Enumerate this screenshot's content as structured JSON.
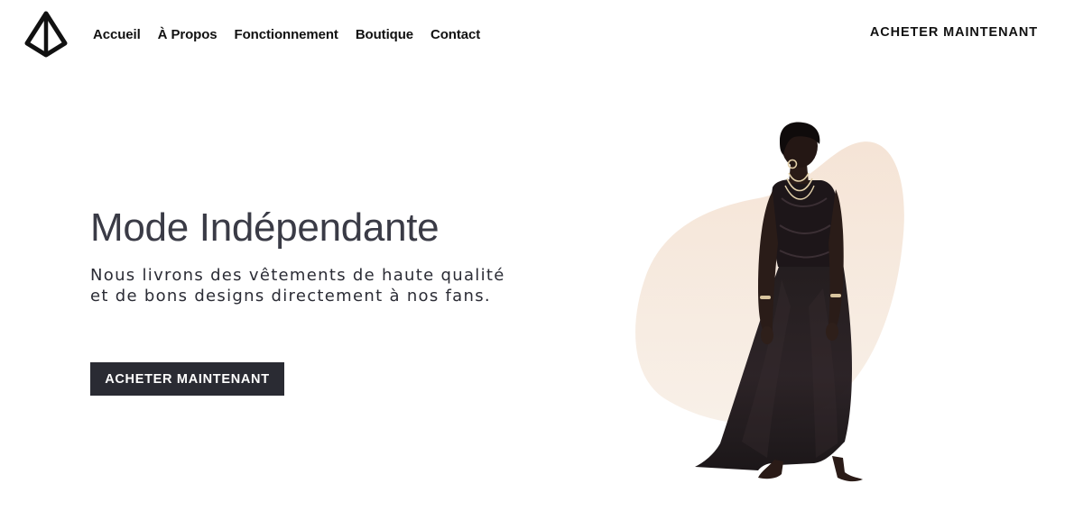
{
  "header": {
    "logo_icon": "diamond-logo-icon",
    "nav": [
      {
        "label": "Accueil"
      },
      {
        "label": "À Propos"
      },
      {
        "label": "Fonctionnement"
      },
      {
        "label": "Boutique"
      },
      {
        "label": "Contact"
      }
    ],
    "cta_label": "ACHETER MAINTENANT"
  },
  "hero": {
    "title": "Mode Indépendante",
    "subtitle": "Nous livrons des vêtements de haute qualité et de bons designs directement à nos fans.",
    "button_label": "ACHETER MAINTENANT",
    "image_icon": "model-in-black-dress-photo"
  },
  "colors": {
    "text_dark": "#111111",
    "title": "#3a3b46",
    "button_bg": "#2a2b33",
    "button_text": "#ffffff",
    "blob": "#f5e6da"
  }
}
